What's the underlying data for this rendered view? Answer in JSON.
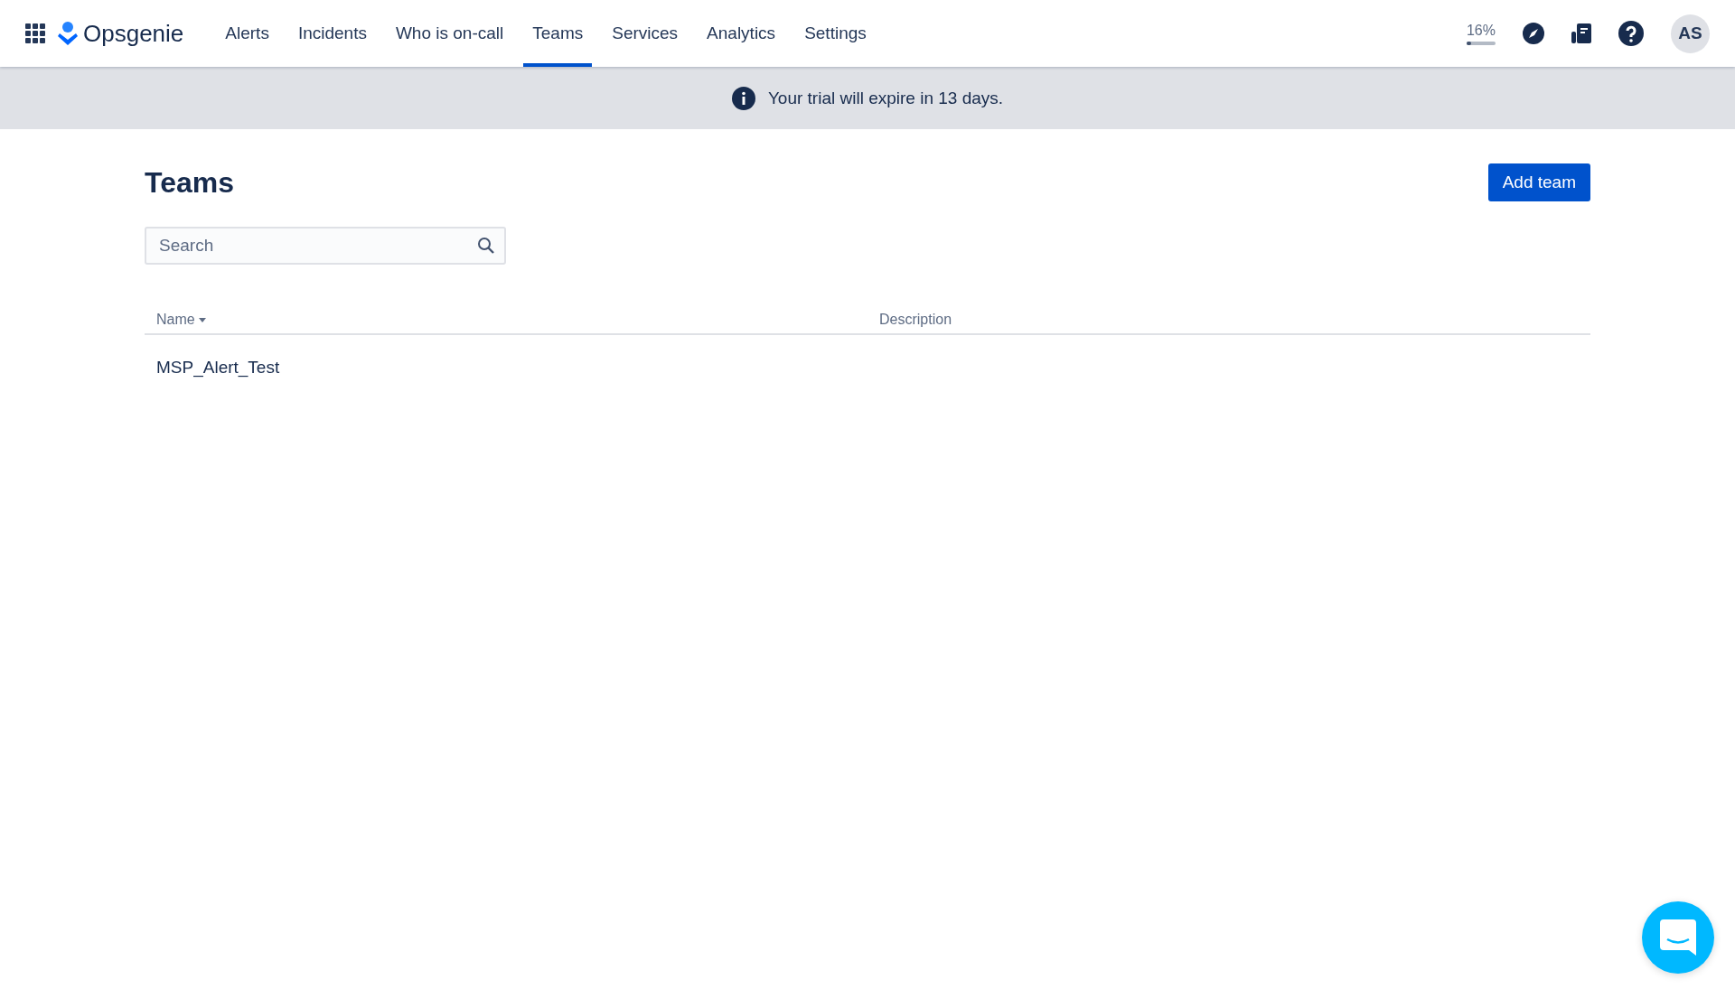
{
  "nav": {
    "logo": "Opsgenie",
    "items": [
      {
        "label": "Alerts",
        "selected": false
      },
      {
        "label": "Incidents",
        "selected": false
      },
      {
        "label": "Who is on-call",
        "selected": false
      },
      {
        "label": "Teams",
        "selected": true
      },
      {
        "label": "Services",
        "selected": false
      },
      {
        "label": "Analytics",
        "selected": false
      },
      {
        "label": "Settings",
        "selected": false
      }
    ],
    "progress": {
      "reading": "16%",
      "level": 0.16
    },
    "avatar": "AS"
  },
  "banner": {
    "text": "Your trial will expire in 13 days."
  },
  "page": {
    "title": "Teams",
    "add_button": "Add team",
    "search": {
      "placeholder": "Search"
    },
    "table": {
      "columns": [
        {
          "label": "Name",
          "sorted": true
        },
        {
          "label": "Description",
          "sorted": false
        }
      ],
      "rows": [
        {
          "name": "MSP_Alert_Test"
        }
      ]
    }
  }
}
